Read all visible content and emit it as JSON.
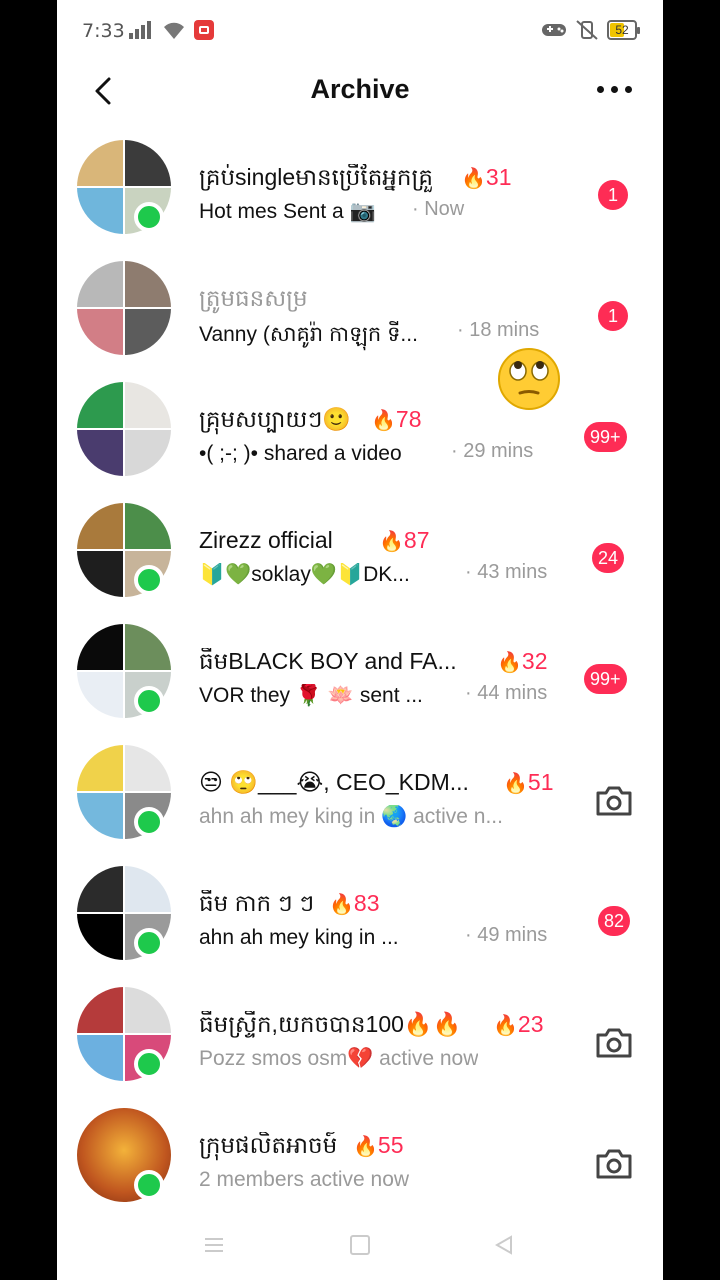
{
  "status_bar": {
    "time": "7:33",
    "battery": "52",
    "colors": {
      "recording": "#e53a3a",
      "battery_fill": "#f0c400"
    }
  },
  "header": {
    "title": "Archive",
    "back_icon": "chevron-left-icon",
    "more_icon": "ellipsis-icon"
  },
  "colors": {
    "accent": "#fe2c55",
    "online": "#1ec94c",
    "secondary_text": "#9a9a9a"
  },
  "chats": [
    {
      "name": "គ្រប់singleមានប្រើតែអ្នកគ្រួ",
      "streak": "31",
      "preview": "Hot mes Sent a 📷",
      "time": "· Now",
      "badge": "1",
      "online": true
    },
    {
      "name": "ត្រូមធនសម្រ",
      "streak": "",
      "preview": "Vanny   (សាគូរ៉ា កាឡុក ទី...",
      "time": "· 18 mins",
      "badge": "1",
      "online": false
    },
    {
      "name": "គ្រុមសប្បាយៗ🙂",
      "streak": "78",
      "preview": "•( ;-; )• shared a video",
      "time": "· 29 mins",
      "badge": "99+",
      "online": false
    },
    {
      "name": "Zirezz official",
      "streak": "87",
      "preview": "🔰💚soklay💚🔰DK...",
      "time": "· 43 mins",
      "badge": "24",
      "online": true
    },
    {
      "name": "ធីមBLACK BOY and FA...",
      "streak": "32",
      "preview": "VOR they 🌹 🪷 sent ...",
      "time": "· 44 mins",
      "badge": "99+",
      "online": true
    },
    {
      "name": "😒 🙄___😭, CEO_KDM...",
      "streak": "51",
      "preview": "ahn ah mey king in 🌏 active n...",
      "time": "",
      "badge": "",
      "online": true
    },
    {
      "name": "ធីម កាក ៗ ៗ",
      "streak": "83",
      "preview": "ahn ah mey king in ...",
      "time": "· 49 mins",
      "badge": "82",
      "online": true
    },
    {
      "name": "ធីមស្ទ្រីក,យកចបាន100🔥🔥",
      "streak": "23",
      "preview": "Pozz smos osm💔 active now",
      "time": "",
      "badge": "",
      "online": true
    },
    {
      "name": "ក្រុមផលិតអាចម៍",
      "streak": "55",
      "preview": "2 members active now",
      "time": "",
      "badge": "",
      "online": true
    }
  ],
  "floating_emoji": "🙄"
}
